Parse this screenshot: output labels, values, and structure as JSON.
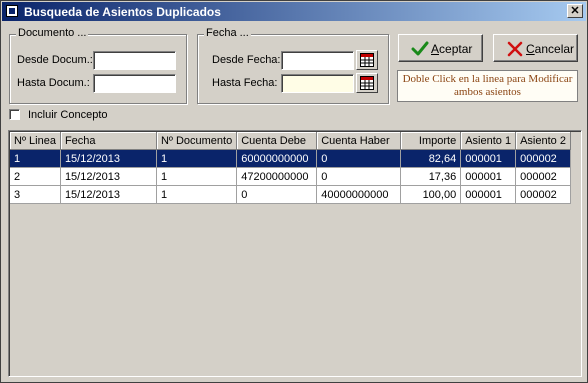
{
  "window": {
    "title": "Busqueda de Asientos Duplicados",
    "icon": "app-icon"
  },
  "documento": {
    "legend": "Documento ...",
    "desde_label": "Desde Docum.:",
    "hasta_label": "Hasta Docum.:",
    "desde_value": "",
    "hasta_value": ""
  },
  "fecha": {
    "legend": "Fecha ...",
    "desde_label": "Desde Fecha:",
    "hasta_label": "Hasta Fecha:",
    "desde_value": "",
    "hasta_value": ""
  },
  "buttons": {
    "aceptar": "Aceptar",
    "aceptar_prefix": "",
    "aceptar_mnemonic": "A",
    "aceptar_rest": "ceptar",
    "cancelar_mnemonic": "C",
    "cancelar_rest": "ancelar",
    "cancelar": "Cancelar"
  },
  "hint": {
    "line1": "Doble Click en la linea para Modificar",
    "line2": "ambos asientos"
  },
  "options": {
    "incluir_concepto": "Incluir Concepto",
    "incluir_concepto_checked": false
  },
  "grid": {
    "columns": [
      "Nº Linea",
      "Fecha",
      "Nº Documento",
      "Cuenta Debe",
      "Cuenta Haber",
      "Importe",
      "Asiento 1",
      "Asiento 2"
    ],
    "rows": [
      [
        "1",
        "15/12/2013",
        "1",
        "60000000000",
        "0",
        "82,64",
        "000001",
        "000002"
      ],
      [
        "2",
        "15/12/2013",
        "1",
        "47200000000",
        "0",
        "17,36",
        "000001",
        "000002"
      ],
      [
        "3",
        "15/12/2013",
        "1",
        "0",
        "40000000000",
        "100,00",
        "000001",
        "000002"
      ]
    ],
    "selected_row": 0
  },
  "colors": {
    "selection": "#0a246a",
    "title_start": "#0a246a",
    "title_end": "#a6caf0",
    "hint_text": "#8b4513",
    "face": "#d4d0c8"
  }
}
